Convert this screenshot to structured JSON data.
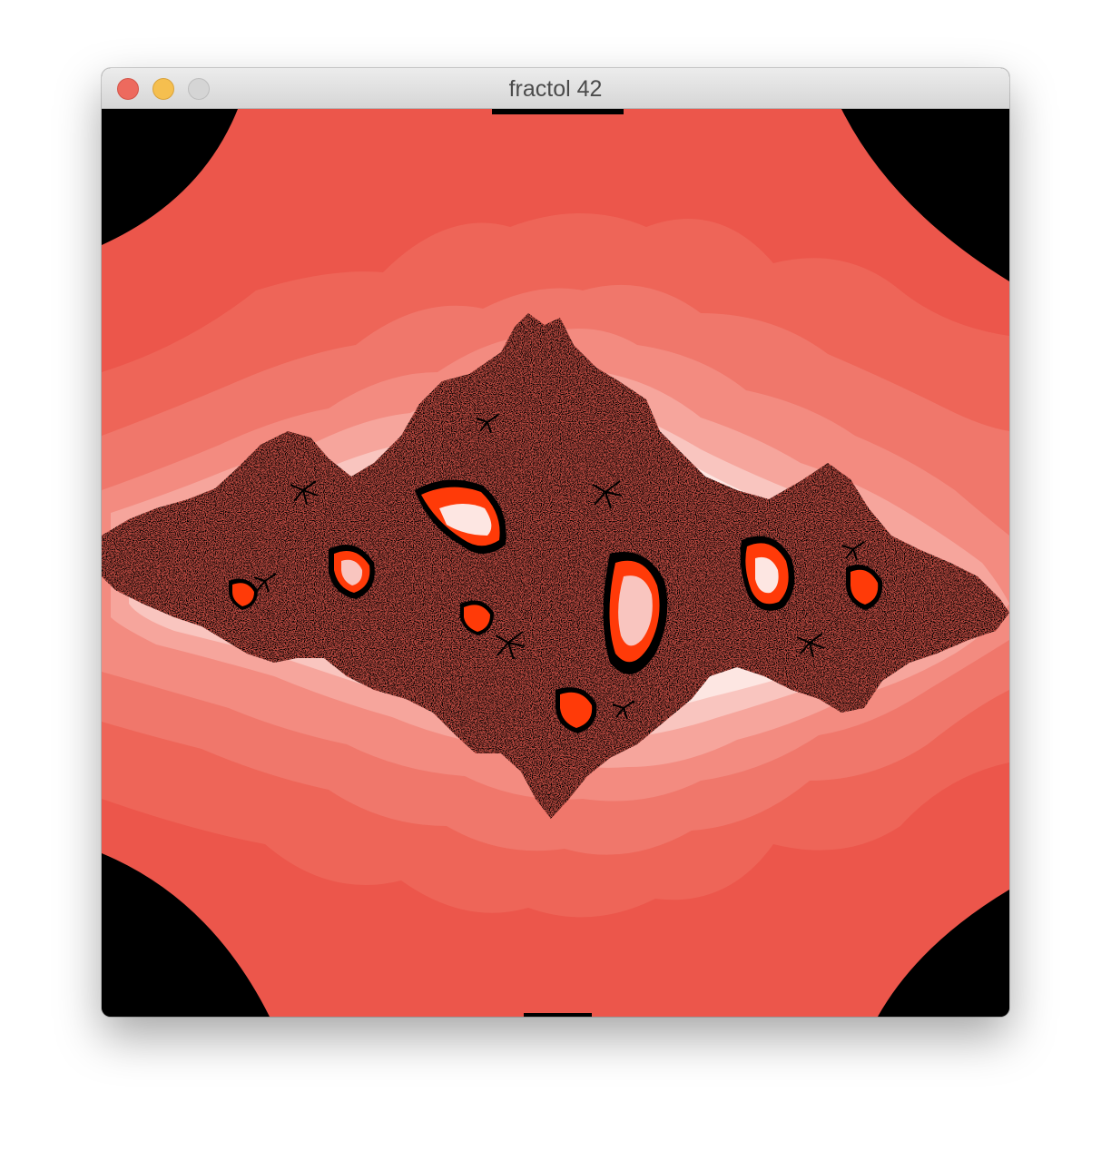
{
  "window": {
    "title": "fractol 42"
  },
  "colors": {
    "escape_0": "#000000",
    "band_1": "#ec564b",
    "band_2": "#ee6558",
    "band_3": "#f0776b",
    "band_4": "#f38b80",
    "band_5": "#f6a59c",
    "band_6": "#f9c5bf",
    "band_7": "#fde6e2",
    "accent_orange": "#ff3a08",
    "accent_red": "#e8160a",
    "titlebar_close": "#ed6a5e",
    "titlebar_minimize": "#f5bf4f",
    "titlebar_zoom": "#d5d5d5"
  }
}
